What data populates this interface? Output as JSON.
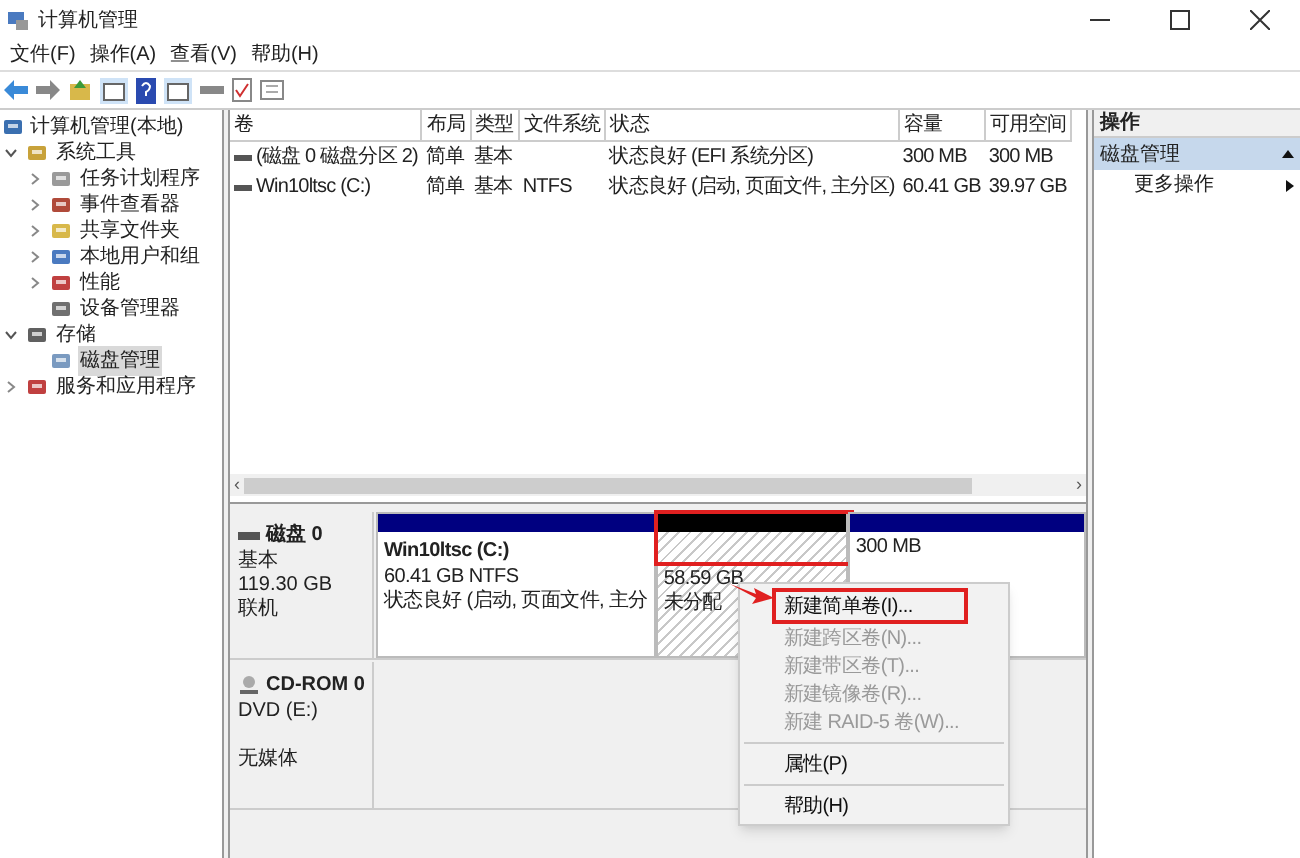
{
  "window": {
    "title": "计算机管理"
  },
  "menu": [
    "文件(F)",
    "操作(A)",
    "查看(V)",
    "帮助(H)"
  ],
  "tree": [
    {
      "label": "计算机管理(本地)",
      "selected": false,
      "children": [
        {
          "label": "系统工具",
          "expanded": true,
          "selected": false,
          "children": [
            {
              "label": "任务计划程序",
              "expanded": false,
              "selected": false
            },
            {
              "label": "事件查看器",
              "expanded": false,
              "selected": false
            },
            {
              "label": "共享文件夹",
              "expanded": false,
              "selected": false
            },
            {
              "label": "本地用户和组",
              "expanded": false,
              "selected": false
            },
            {
              "label": "性能",
              "expanded": false,
              "selected": false
            },
            {
              "label": "设备管理器",
              "selected": false
            }
          ]
        },
        {
          "label": "存储",
          "expanded": true,
          "selected": false,
          "children": [
            {
              "label": "磁盘管理",
              "selected": true
            }
          ]
        },
        {
          "label": "服务和应用程序",
          "expanded": false,
          "selected": false
        }
      ]
    }
  ],
  "table": {
    "columns": [
      "卷",
      "布局",
      "类型",
      "文件系统",
      "状态",
      "容量",
      "可用空间"
    ],
    "rows": [
      [
        "(磁盘 0 磁盘分区 2)",
        "简单",
        "基本",
        "",
        "状态良好 (EFI 系统分区)",
        "300 MB",
        "300 MB"
      ],
      [
        "Win10ltsc (C:)",
        "简单",
        "基本",
        "NTFS",
        "状态良好 (启动, 页面文件, 主分区)",
        "60.41 GB",
        "39.97 GB"
      ]
    ],
    "scroll_left": "‹",
    "scroll_right": "›"
  },
  "disks": [
    {
      "name": "磁盘 0",
      "kind": "disk",
      "lines": [
        "基本",
        "119.30 GB",
        "联机"
      ],
      "partitions": [
        {
          "kind": "primary",
          "title": "Win10ltsc  (C:)",
          "lines": [
            "60.41 GB NTFS",
            "状态良好 (启动, 页面文件, 主分"
          ]
        },
        {
          "kind": "unallocated",
          "lines": [
            "58.59 GB",
            "未分配"
          ]
        },
        {
          "kind": "primary",
          "lines": [
            "300 MB"
          ]
        }
      ]
    },
    {
      "name": "CD-ROM 0",
      "kind": "cdrom",
      "lines": [
        "DVD (E:)",
        "无媒体"
      ]
    }
  ],
  "context_menu": [
    {
      "kind": "item",
      "label": "新建简单卷(I)...",
      "disabled": false
    },
    {
      "kind": "item",
      "label": "新建跨区卷(N)...",
      "disabled": true
    },
    {
      "kind": "item",
      "label": "新建带区卷(T)...",
      "disabled": true
    },
    {
      "kind": "item",
      "label": "新建镜像卷(R)...",
      "disabled": true
    },
    {
      "kind": "item",
      "label": "新建 RAID-5 卷(W)...",
      "disabled": true
    },
    {
      "kind": "separator"
    },
    {
      "kind": "item",
      "label": "属性(P)",
      "disabled": false
    },
    {
      "kind": "separator"
    },
    {
      "kind": "item",
      "label": "帮助(H)",
      "disabled": false
    }
  ],
  "actions": {
    "title": "操作",
    "section": "磁盘管理",
    "items": [
      "更多操作"
    ]
  }
}
